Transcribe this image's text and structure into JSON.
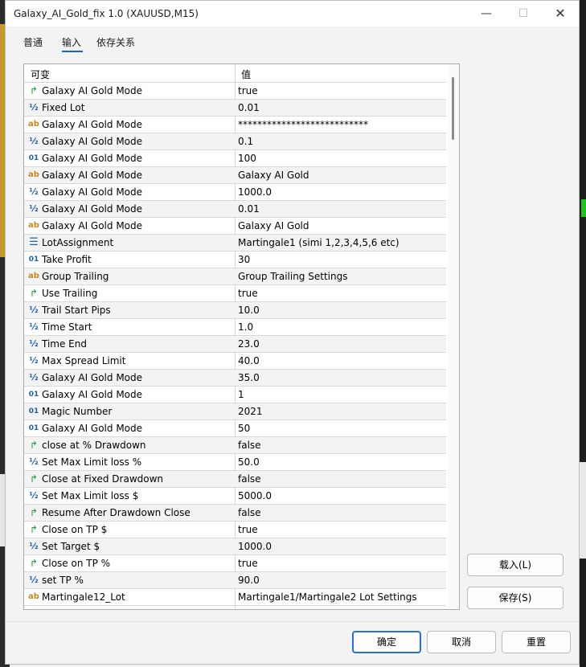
{
  "window": {
    "title": "Galaxy_AI_Gold_fix 1.0 (XAUUSD,M15)"
  },
  "controls": {
    "minimize": "—",
    "maximize": "☐",
    "close": "✕"
  },
  "tabs": [
    {
      "label": "普通",
      "active": false
    },
    {
      "label": "输入",
      "active": true
    },
    {
      "label": "依存关系",
      "active": false
    }
  ],
  "grid": {
    "headers": {
      "variable": "可变",
      "value": "值"
    },
    "rows": [
      {
        "icon": "bool",
        "name": "Galaxy AI Gold Mode",
        "value": "true"
      },
      {
        "icon": "half",
        "name": "Fixed Lot",
        "value": "0.01"
      },
      {
        "icon": "str",
        "name": "Galaxy AI Gold Mode",
        "value": "***************************"
      },
      {
        "icon": "half",
        "name": "Galaxy AI Gold Mode",
        "value": "0.1"
      },
      {
        "icon": "int",
        "name": "Galaxy AI Gold Mode",
        "value": "100"
      },
      {
        "icon": "str",
        "name": "Galaxy AI Gold Mode",
        "value": "Galaxy AI Gold"
      },
      {
        "icon": "half",
        "name": "Galaxy AI Gold Mode",
        "value": "1000.0"
      },
      {
        "icon": "half",
        "name": "Galaxy AI Gold Mode",
        "value": "0.01"
      },
      {
        "icon": "str",
        "name": "Galaxy AI Gold Mode",
        "value": "Galaxy AI Gold"
      },
      {
        "icon": "enum",
        "name": "LotAssignment",
        "value": "Martingale1 (simi 1,2,3,4,5,6 etc)"
      },
      {
        "icon": "int",
        "name": "Take Profit",
        "value": "30"
      },
      {
        "icon": "str",
        "name": "Group Trailing",
        "value": " Group Trailing Settings"
      },
      {
        "icon": "bool",
        "name": "Use Trailing",
        "value": "true"
      },
      {
        "icon": "half",
        "name": "Trail Start Pips",
        "value": "10.0"
      },
      {
        "icon": "half",
        "name": "Time Start",
        "value": "1.0"
      },
      {
        "icon": "half",
        "name": "Time End",
        "value": "23.0"
      },
      {
        "icon": "half",
        "name": "Max Spread Limit",
        "value": "40.0"
      },
      {
        "icon": "half",
        "name": "Galaxy AI Gold Mode",
        "value": "35.0"
      },
      {
        "icon": "int",
        "name": "Galaxy AI Gold Mode",
        "value": "1"
      },
      {
        "icon": "int",
        "name": "Magic Number",
        "value": "2021"
      },
      {
        "icon": "int",
        "name": "Galaxy AI Gold Mode",
        "value": "50"
      },
      {
        "icon": "bool",
        "name": "close at % Drawdown",
        "value": "false"
      },
      {
        "icon": "half",
        "name": "Set Max Limit loss %",
        "value": "50.0"
      },
      {
        "icon": "bool",
        "name": "Close at Fixed Drawdown",
        "value": "false"
      },
      {
        "icon": "half",
        "name": "Set Max Limit loss $",
        "value": "5000.0"
      },
      {
        "icon": "bool",
        "name": "Resume After Drawdown Close",
        "value": "false"
      },
      {
        "icon": "bool",
        "name": "Close on TP $",
        "value": "true"
      },
      {
        "icon": "half",
        "name": "Set Target $",
        "value": "1000.0"
      },
      {
        "icon": "bool",
        "name": "Close on TP %",
        "value": "true"
      },
      {
        "icon": "half",
        "name": "set TP %",
        "value": "90.0"
      },
      {
        "icon": "str",
        "name": "Martingale12_Lot",
        "value": "Martingale1/Martingale2 Lot Settings"
      }
    ]
  },
  "icons": {
    "bool": "↱",
    "half": "½",
    "str": "ab",
    "int": "01",
    "enum": "☰"
  },
  "buttons": {
    "load": "载入(L)",
    "save": "保存(S)",
    "ok": "确定",
    "cancel": "取消",
    "reset": "重置"
  }
}
